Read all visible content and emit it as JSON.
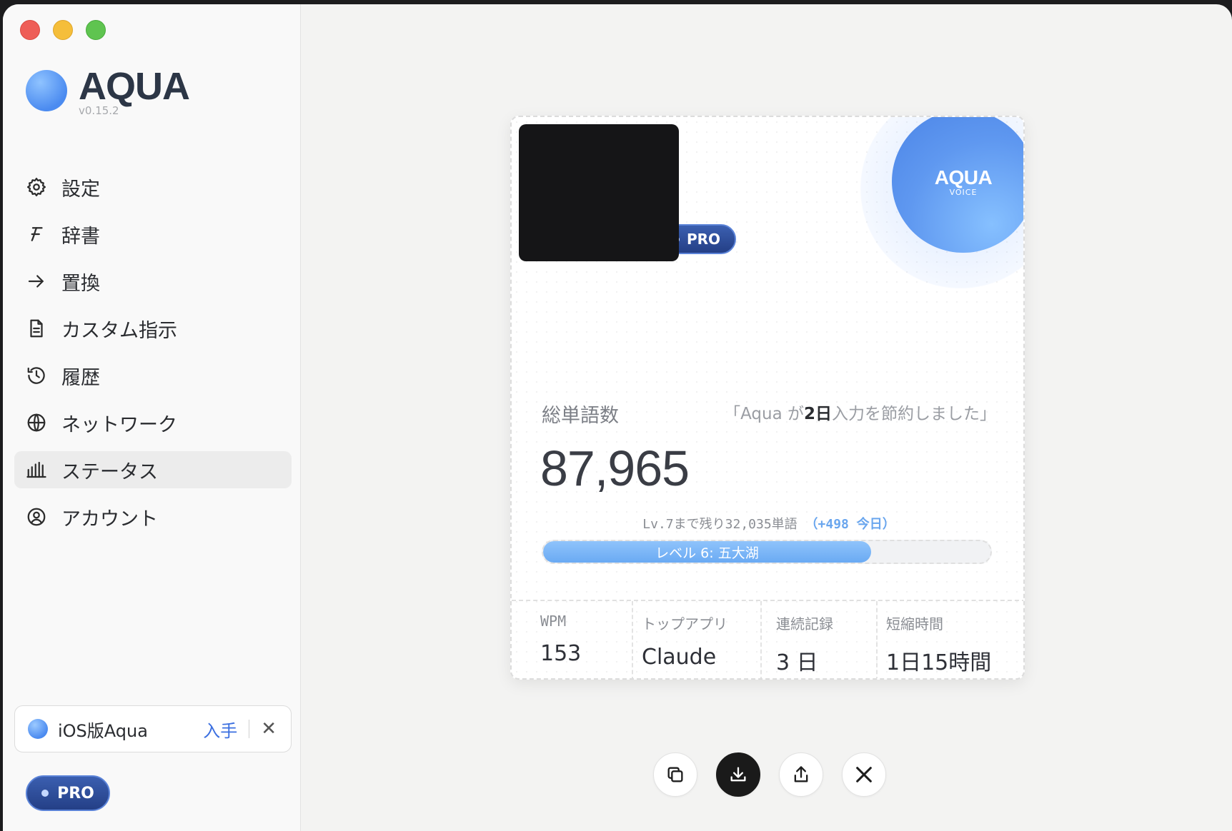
{
  "app": {
    "name": "AQUA",
    "version": "v0.15.2"
  },
  "sidebar": {
    "items": [
      {
        "label": "設定",
        "icon": "gear-icon"
      },
      {
        "label": "辞書",
        "icon": "dictionary-icon"
      },
      {
        "label": "置換",
        "icon": "arrow-right-icon"
      },
      {
        "label": "カスタム指示",
        "icon": "document-icon"
      },
      {
        "label": "履歴",
        "icon": "history-icon"
      },
      {
        "label": "ネットワーク",
        "icon": "globe-icon"
      },
      {
        "label": "ステータス",
        "icon": "bars-icon",
        "active": true
      },
      {
        "label": "アカウント",
        "icon": "account-icon"
      }
    ],
    "ios_banner": {
      "label": "iOS版Aqua",
      "action": "入手"
    },
    "plan_badge": "PRO"
  },
  "card": {
    "plan_badge": "PRO",
    "logo_name": "AQUA",
    "logo_sub": "VOICE",
    "title": "総単語数",
    "saved_prefix": "「Aqua が",
    "saved_days": "2日",
    "saved_suffix": "入力を節約しました」",
    "total_words": "87,965",
    "level_note_prefix": "Lv.7まで残り32,035単語",
    "level_note_today": "（+498 今日）",
    "level_label": "レベル 6: 五大湖",
    "level_progress": 0.733,
    "stats": [
      {
        "label": "WPM",
        "value": "153"
      },
      {
        "label": "トップアプリ",
        "value": "Claude"
      },
      {
        "label": "連続記録",
        "value": "3 日"
      },
      {
        "label": "短縮時間",
        "value": "1日15時間"
      }
    ]
  },
  "actions": [
    {
      "icon": "copy-icon"
    },
    {
      "icon": "download-icon"
    },
    {
      "icon": "share-icon"
    },
    {
      "icon": "x-logo-icon"
    }
  ]
}
